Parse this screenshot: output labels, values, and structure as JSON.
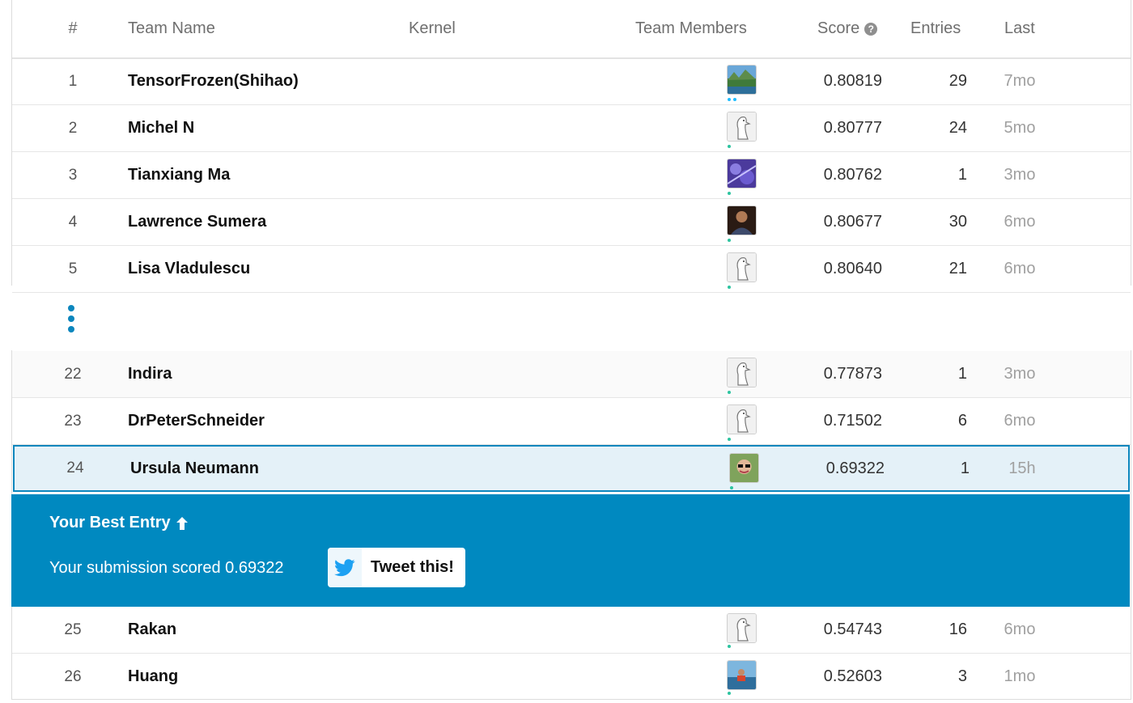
{
  "header": {
    "rank": "#",
    "team_name": "Team Name",
    "kernel": "Kernel",
    "team_members": "Team Members",
    "score": "Score",
    "entries": "Entries",
    "last": "Last"
  },
  "top_rows": [
    {
      "rank": "1",
      "name": "TensorFrozen(Shihao)",
      "score": "0.80819",
      "entries": "29",
      "last": "7mo",
      "avatar": "landscape-photo"
    },
    {
      "rank": "2",
      "name": "Michel N",
      "score": "0.80777",
      "entries": "24",
      "last": "5mo",
      "avatar": "default-goose"
    },
    {
      "rank": "3",
      "name": "Tianxiang Ma",
      "score": "0.80762",
      "entries": "1",
      "last": "3mo",
      "avatar": "purple-abstract"
    },
    {
      "rank": "4",
      "name": "Lawrence Sumera",
      "score": "0.80677",
      "entries": "30",
      "last": "6mo",
      "avatar": "person-photo"
    },
    {
      "rank": "5",
      "name": "Lisa Vladulescu",
      "score": "0.80640",
      "entries": "21",
      "last": "6mo",
      "avatar": "default-goose"
    }
  ],
  "bottom_rows": [
    {
      "rank": "22",
      "name": "Indira",
      "score": "0.77873",
      "entries": "1",
      "last": "3mo",
      "avatar": "default-goose"
    },
    {
      "rank": "23",
      "name": "DrPeterSchneider",
      "score": "0.71502",
      "entries": "6",
      "last": "6mo",
      "avatar": "default-goose"
    },
    {
      "rank": "24",
      "name": "Ursula Neumann",
      "score": "0.69322",
      "entries": "1",
      "last": "15h",
      "avatar": "person-photo-sunglasses"
    },
    {
      "rank": "25",
      "name": "Rakan",
      "score": "0.54743",
      "entries": "16",
      "last": "6mo",
      "avatar": "default-goose"
    },
    {
      "rank": "26",
      "name": "Huang",
      "score": "0.52603",
      "entries": "3",
      "last": "1mo",
      "avatar": "kayak-photo"
    }
  ],
  "best_entry": {
    "title": "Your Best Entry",
    "message": "Your submission scored 0.69322",
    "tweet_label": "Tweet this!"
  },
  "colors": {
    "accent": "#0089c0",
    "highlight_row": "#e4f1f8",
    "muted_text": "#a0a0a0"
  }
}
